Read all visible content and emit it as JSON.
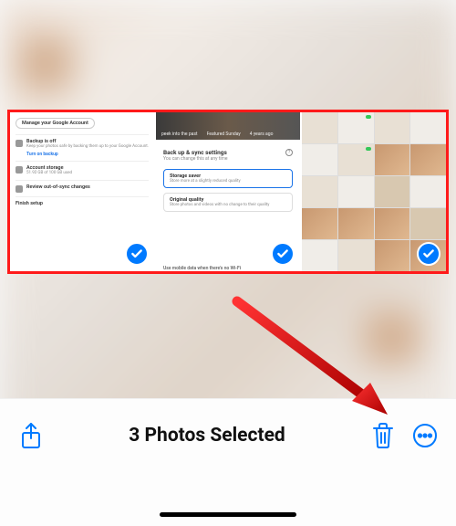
{
  "colors": {
    "highlight": "#ff1a1a",
    "accent": "#007aff",
    "arrow": "#cc0000"
  },
  "toolbar": {
    "title": "3 Photos Selected"
  },
  "thumb1": {
    "manage_btn": "Manage your Google Account",
    "backup_title": "Backup is off",
    "backup_sub": "Keep your photos safe by backing them up to your Google Account.",
    "turn_on": "Turn on backup",
    "storage_title": "Account storage",
    "storage_sub": "51.92 GB of 100 GB used",
    "review": "Review out-of-sync changes",
    "finish": "Finish setup"
  },
  "thumb2": {
    "tag1": "peek into the past",
    "tag2": "Featured Sunday",
    "tag3": "4 years ago",
    "title": "Back up & sync settings",
    "sub": "You can change this at any time",
    "opt1_title": "Storage saver",
    "opt1_sub": "Store more at a slightly reduced quality",
    "opt2_title": "Original quality",
    "opt2_sub": "Store photos and videos with no change to their quality",
    "footer": "Use mobile data when there's no Wi-Fi"
  }
}
